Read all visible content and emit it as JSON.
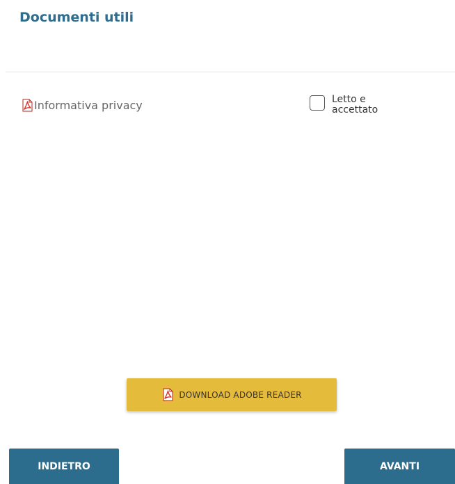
{
  "section": {
    "title": "Documenti utili"
  },
  "documents": [
    {
      "icon": "pdf-icon",
      "label": "Informativa privacy",
      "checkbox_label": "Letto e accettato",
      "checked": false
    }
  ],
  "adobe": {
    "icon": "pdf-icon",
    "label": "DOWNLOAD ADOBE READER"
  },
  "navigation": {
    "back_label": "INDIETRO",
    "next_label": "AVANTI"
  },
  "colors": {
    "title": "#2e6d8e",
    "nav_button": "#2c6c8c",
    "adobe_button": "#e5bb3c",
    "pdf_icon": "#d9342b"
  }
}
